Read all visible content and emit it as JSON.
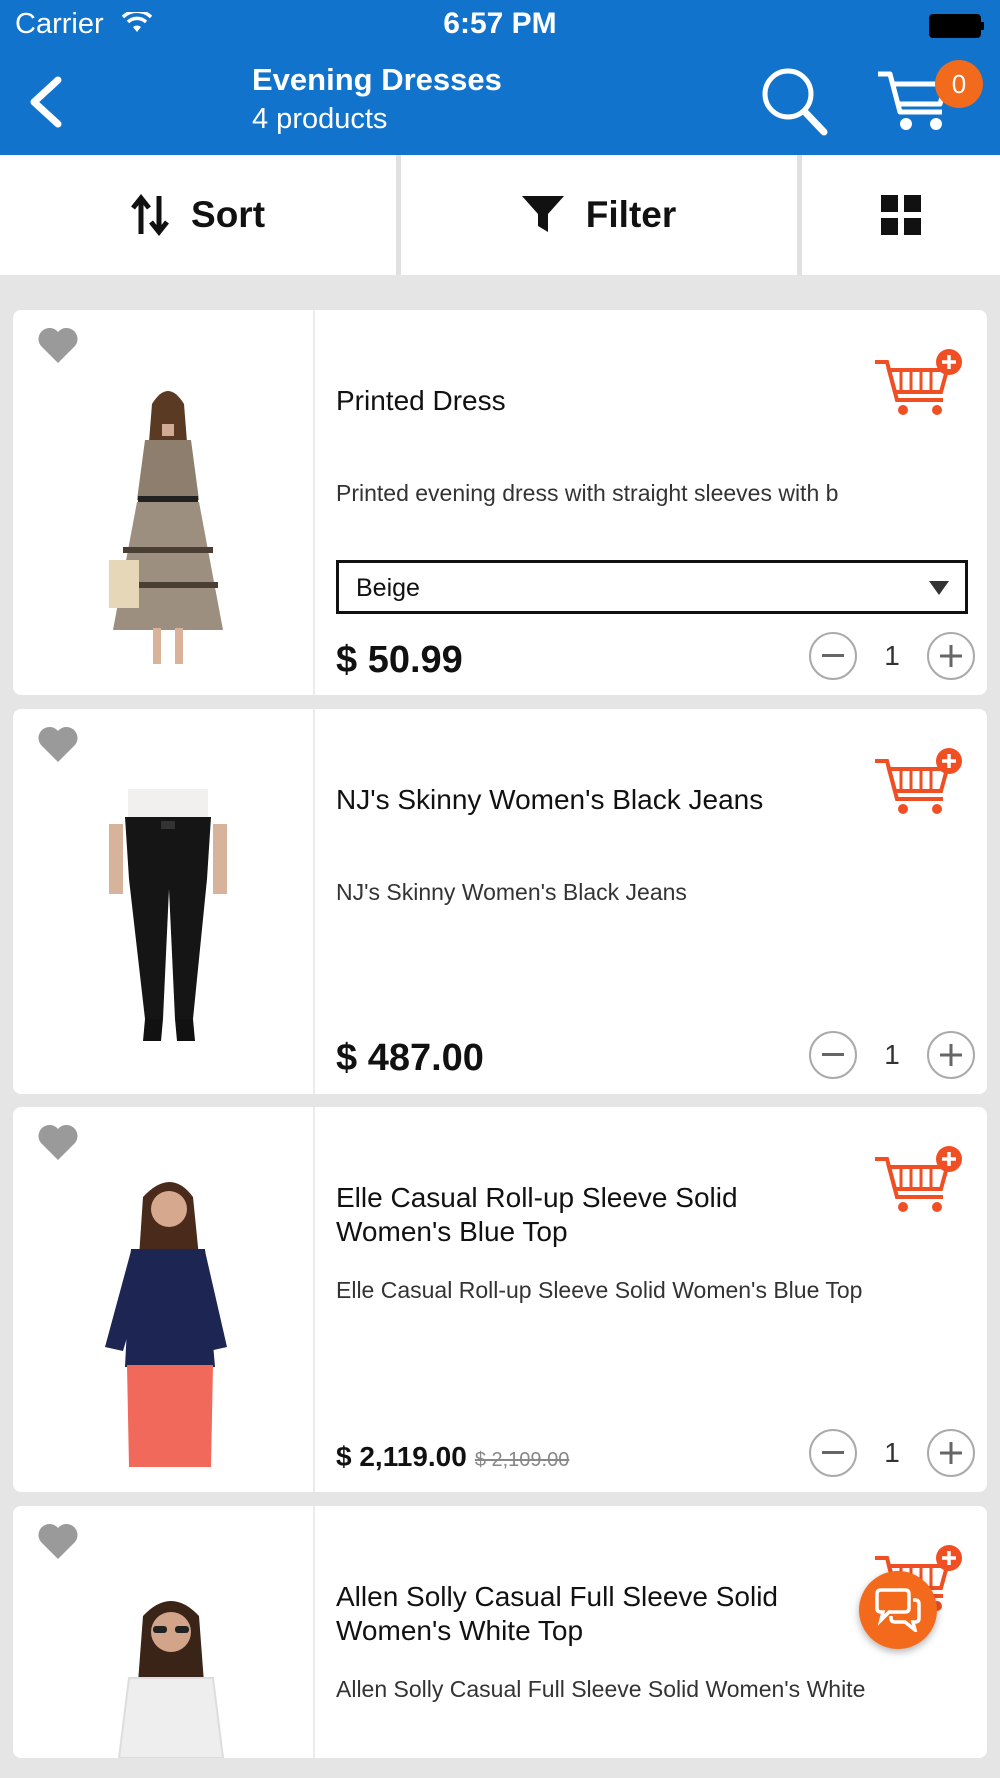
{
  "status_bar": {
    "carrier": "Carrier",
    "time": "6:57 PM"
  },
  "header": {
    "title": "Evening Dresses",
    "subtitle": "4 products",
    "cart_count": "0",
    "icons": [
      "back-icon",
      "search-icon",
      "cart-icon"
    ]
  },
  "toolbar": {
    "sort_label": "Sort",
    "filter_label": "Filter",
    "icons": [
      "sort-icon",
      "filter-icon",
      "grid-view-icon"
    ]
  },
  "products": [
    {
      "name": "Printed Dress",
      "description": "Printed evening dress with straight sleeves with b",
      "variant": "Beige",
      "price": "$ 50.99",
      "quantity": "1"
    },
    {
      "name": "NJ's Skinny Women's Black Jeans",
      "description": "NJ's Skinny Women's Black Jeans",
      "price": "$ 487.00",
      "quantity": "1"
    },
    {
      "name_line1": "Elle Casual Roll-up Sleeve Solid",
      "name_line2": "Women's Blue Top",
      "description": "Elle Casual Roll-up Sleeve Solid Women's Blue Top",
      "price": "$ 2,119.00",
      "old_price": "$ 2,109.00",
      "quantity": "1"
    },
    {
      "name_line1": "Allen Solly Casual Full Sleeve Solid",
      "name_line2": "Women's White Top",
      "description": "Allen Solly Casual Full Sleeve Solid Women's White"
    }
  ],
  "colors": {
    "primary": "#1173cc",
    "accent": "#f26a1b",
    "background": "#e5e5e5"
  }
}
